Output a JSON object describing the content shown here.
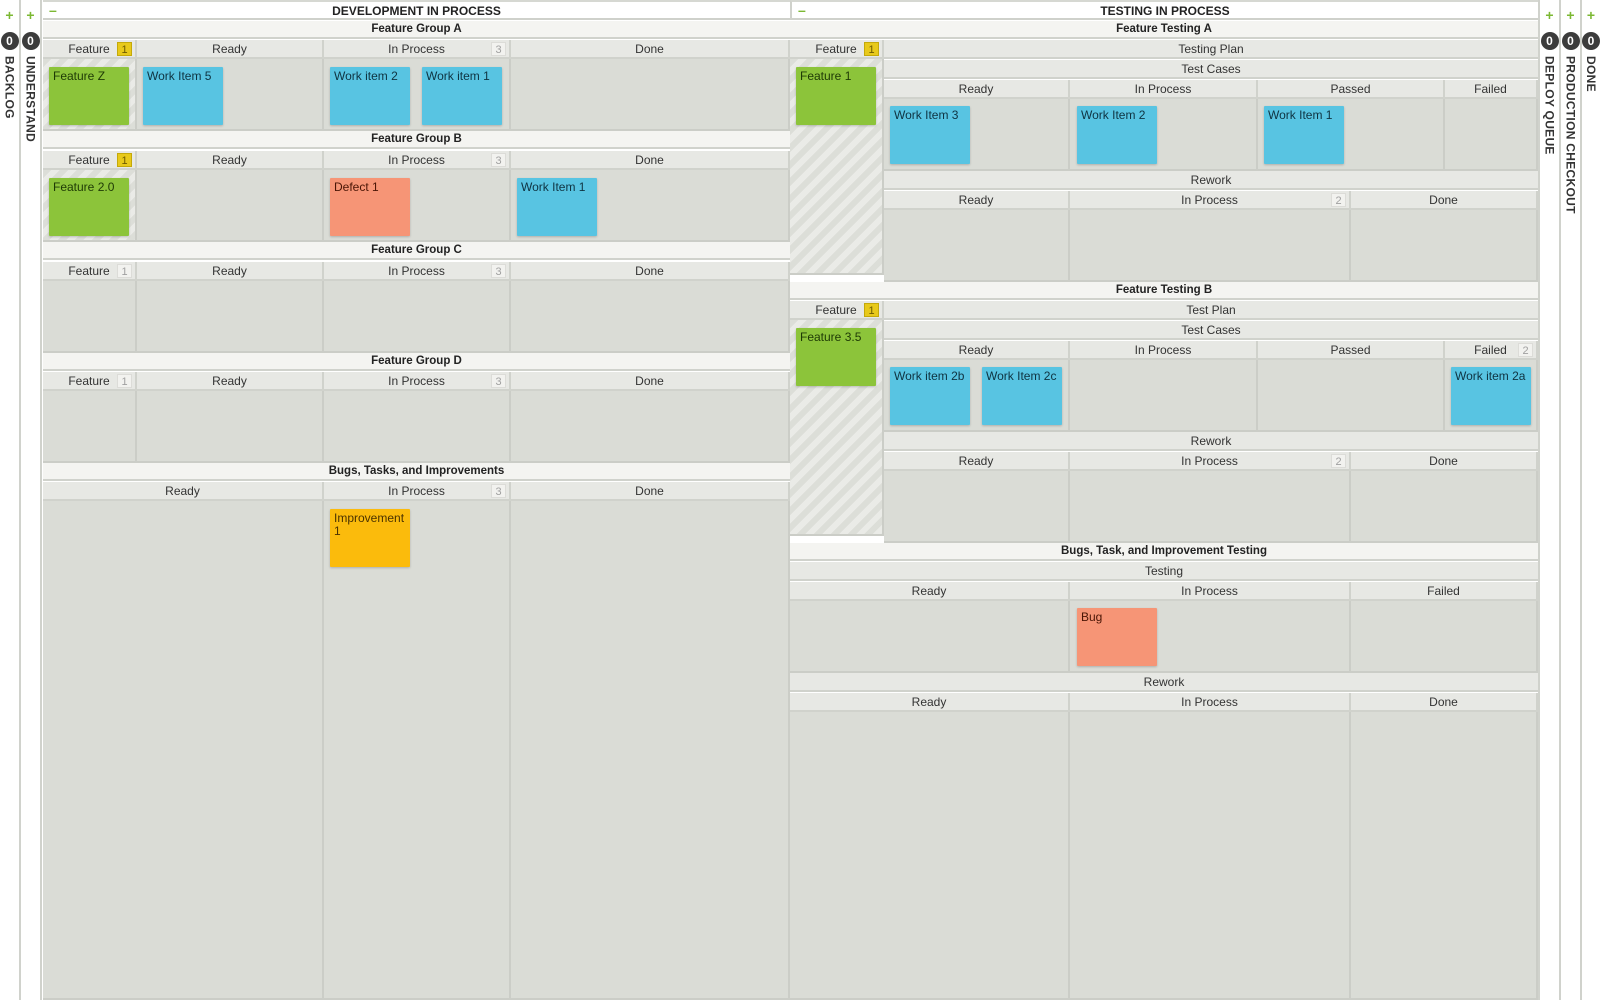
{
  "colors": {
    "feature_card": "#8cc43a",
    "work_item_card": "#58c4e2",
    "defect_card": "#f69576",
    "improvement_card": "#fbbb0c",
    "accent_plus": "#7cb833",
    "wip_limit_badge": "#e8c91a"
  },
  "left_lanes": [
    {
      "label": "BACKLOG",
      "count": "0",
      "icon": "plus-icon"
    },
    {
      "label": "UNDERSTAND",
      "count": "0",
      "icon": "plus-icon"
    }
  ],
  "right_lanes": [
    {
      "label": "DEPLOY QUEUE",
      "count": "0",
      "icon": "plus-icon"
    },
    {
      "label": "PRODUCTION CHECKOUT",
      "count": "0",
      "icon": "plus-icon"
    },
    {
      "label": "DONE",
      "count": "0",
      "icon": "plus-icon"
    }
  ],
  "development": {
    "title": "DEVELOPMENT IN PROCESS",
    "collapse_icon": "minus-icon",
    "groups": [
      {
        "title": "Feature Group A",
        "columns": [
          {
            "label": "Feature",
            "wip": "1",
            "wip_style": "yellow"
          },
          {
            "label": "Ready"
          },
          {
            "label": "In Process",
            "wip": "3",
            "wip_style": "grey"
          },
          {
            "label": "Done"
          }
        ],
        "cards": {
          "feature": [
            {
              "title": "Feature Z",
              "type": "feature"
            }
          ],
          "ready": [
            {
              "title": "Work Item 5",
              "type": "work-item"
            }
          ],
          "in_process": [
            {
              "title": "Work item 2",
              "type": "work-item"
            },
            {
              "title": "Work item 1",
              "type": "work-item"
            }
          ],
          "done": []
        }
      },
      {
        "title": "Feature Group B",
        "columns": [
          {
            "label": "Feature",
            "wip": "1",
            "wip_style": "yellow"
          },
          {
            "label": "Ready"
          },
          {
            "label": "In Process",
            "wip": "3",
            "wip_style": "grey"
          },
          {
            "label": "Done"
          }
        ],
        "cards": {
          "feature": [
            {
              "title": "Feature 2.0",
              "type": "feature"
            }
          ],
          "ready": [],
          "in_process": [
            {
              "title": "Defect 1",
              "type": "defect"
            }
          ],
          "done": [
            {
              "title": "Work Item 1",
              "type": "work-item"
            }
          ]
        }
      },
      {
        "title": "Feature Group C",
        "columns": [
          {
            "label": "Feature",
            "wip": "1",
            "wip_style": "grey"
          },
          {
            "label": "Ready"
          },
          {
            "label": "In Process",
            "wip": "3",
            "wip_style": "grey"
          },
          {
            "label": "Done"
          }
        ]
      },
      {
        "title": "Feature Group D",
        "columns": [
          {
            "label": "Feature",
            "wip": "1",
            "wip_style": "grey"
          },
          {
            "label": "Ready"
          },
          {
            "label": "In Process",
            "wip": "3",
            "wip_style": "grey"
          },
          {
            "label": "Done"
          }
        ]
      },
      {
        "title": "Bugs, Tasks, and Improvements",
        "columns": [
          {
            "label": "Ready"
          },
          {
            "label": "In Process",
            "wip": "3",
            "wip_style": "grey"
          },
          {
            "label": "Done"
          }
        ],
        "cards": {
          "in_process": [
            {
              "title": "Improvement 1",
              "type": "improvement"
            }
          ]
        }
      }
    ]
  },
  "testing": {
    "title": "TESTING IN PROCESS",
    "collapse_icon": "minus-icon",
    "feature_testing_a": {
      "title": "Feature Testing A",
      "feature_col": {
        "label": "Feature",
        "wip": "1"
      },
      "feature_card": {
        "title": "Feature 1",
        "type": "feature"
      },
      "plan_label": "Testing Plan",
      "test_cases_label": "Test Cases",
      "test_columns": [
        "Ready",
        "In Process",
        "Passed",
        "Failed"
      ],
      "test_cards": {
        "ready": [
          {
            "title": "Work Item 3",
            "type": "work-item"
          }
        ],
        "in_process": [
          {
            "title": "Work Item 2",
            "type": "work-item"
          }
        ],
        "passed": [
          {
            "title": "Work Item 1",
            "type": "work-item"
          }
        ],
        "failed": []
      },
      "rework_label": "Rework",
      "rework_columns": [
        {
          "label": "Ready"
        },
        {
          "label": "In Process",
          "wip": "2"
        },
        {
          "label": "Done"
        }
      ]
    },
    "feature_testing_b": {
      "title": "Feature Testing B",
      "feature_col": {
        "label": "Feature",
        "wip": "1"
      },
      "feature_card": {
        "title": "Feature 3.5",
        "type": "feature"
      },
      "plan_label": "Test Plan",
      "test_cases_label": "Test Cases",
      "test_columns": [
        {
          "label": "Ready"
        },
        {
          "label": "In Process"
        },
        {
          "label": "Passed"
        },
        {
          "label": "Failed",
          "wip": "2"
        }
      ],
      "test_cards": {
        "ready": [
          {
            "title": "Work item 2b",
            "type": "work-item"
          },
          {
            "title": "Work Item 2c",
            "type": "work-item"
          }
        ],
        "in_process": [],
        "passed": [],
        "failed": [
          {
            "title": "Work item 2a",
            "type": "work-item"
          }
        ]
      },
      "rework_label": "Rework",
      "rework_columns": [
        {
          "label": "Ready"
        },
        {
          "label": "In Process",
          "wip": "2"
        },
        {
          "label": "Done"
        }
      ]
    },
    "bugs_testing": {
      "title": "Bugs, Task, and Improvement Testing",
      "testing_label": "Testing",
      "testing_columns": [
        "Ready",
        "In Process",
        "Failed"
      ],
      "testing_cards": {
        "in_process": [
          {
            "title": "Bug",
            "type": "defect"
          }
        ]
      },
      "rework_label": "Rework",
      "rework_columns": [
        "Ready",
        "In Process",
        "Done"
      ]
    }
  }
}
